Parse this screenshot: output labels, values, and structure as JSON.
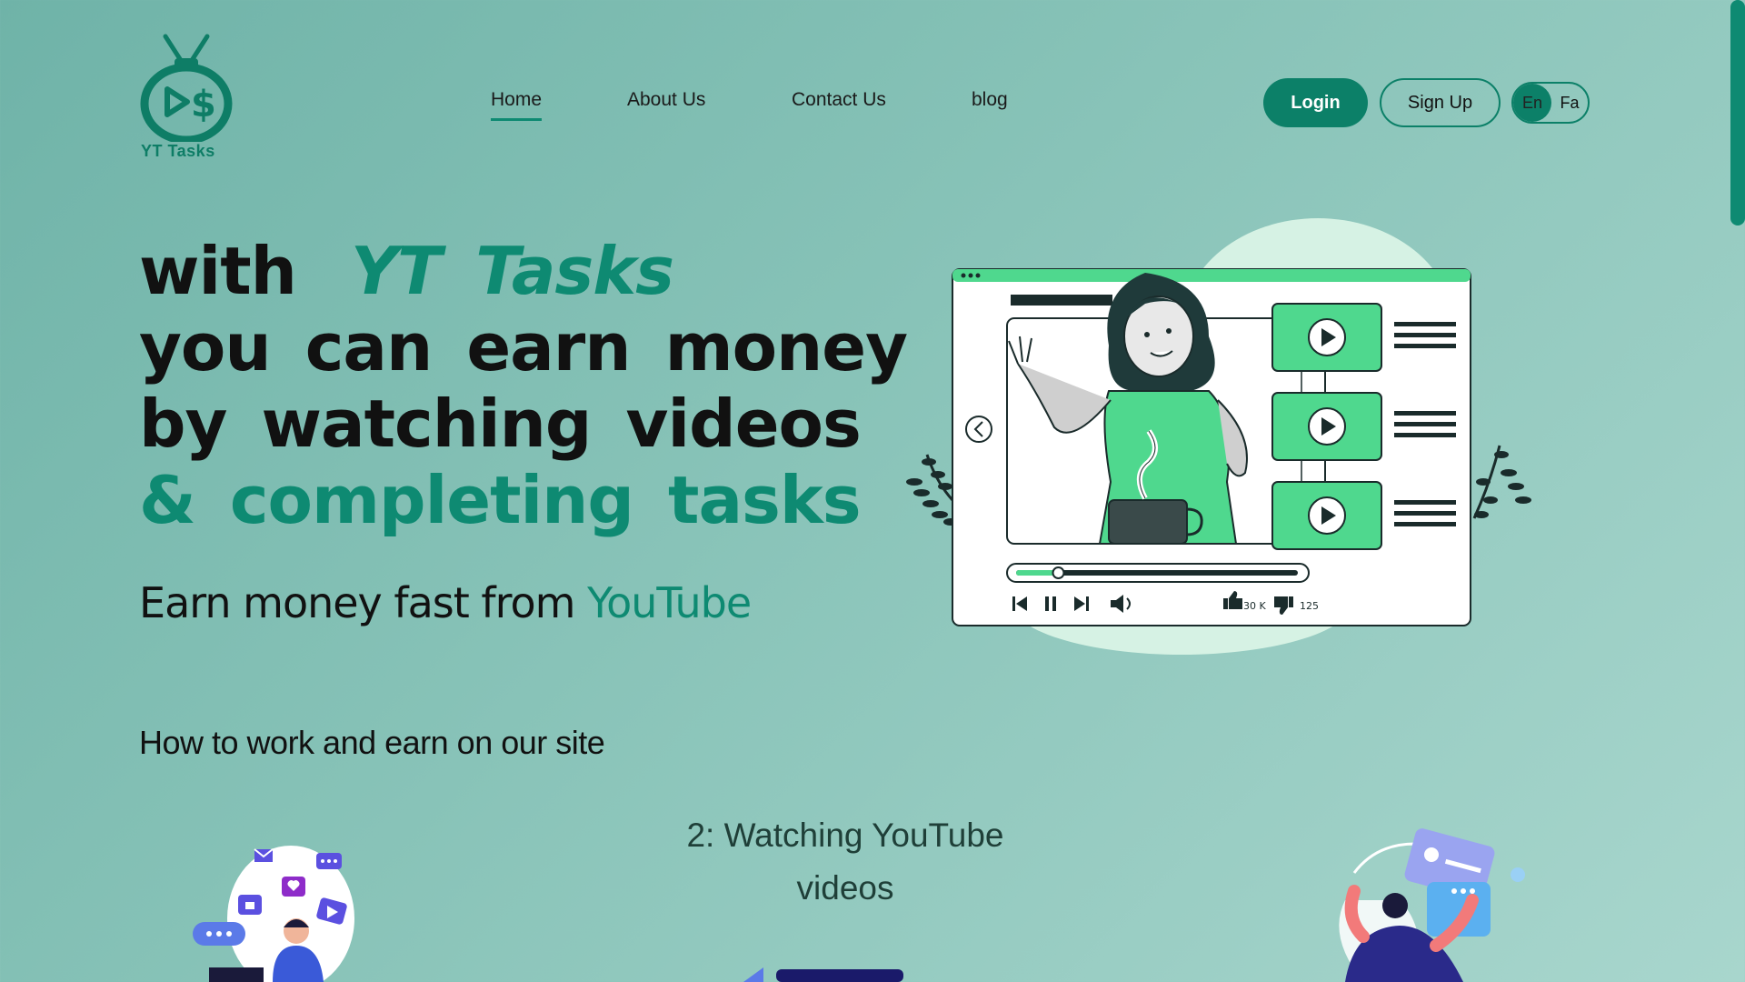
{
  "brand": {
    "logo_text": "YT Tasks",
    "accent": "#0e8a72",
    "button_green": "#0c8068"
  },
  "nav": {
    "items": [
      {
        "label": "Home",
        "active": true
      },
      {
        "label": "About Us"
      },
      {
        "label": "Contact Us"
      },
      {
        "label": "blog"
      }
    ]
  },
  "auth": {
    "login_label": "Login",
    "signup_label": "Sign Up"
  },
  "language": {
    "options": [
      "En",
      "Fa"
    ],
    "selected": "En"
  },
  "hero": {
    "line1_prefix": "with",
    "line1_brand": "YT Tasks",
    "line2": "you can earn money",
    "line3": "by watching videos",
    "line4": "& completing tasks",
    "subline_prefix": "Earn money fast from",
    "subline_highlight": "YouTube"
  },
  "video_player": {
    "likes": "30 K",
    "dislikes": "125",
    "progress": 0.15,
    "icons": [
      "back-arrow-icon",
      "play-icon",
      "skip-back-icon",
      "pause-icon",
      "skip-forward-icon",
      "volume-icon",
      "thumbs-up-icon",
      "thumbs-down-icon"
    ]
  },
  "how_section": {
    "title": "How to work and earn on our site",
    "step_title_line1": "2: Watching YouTube",
    "step_title_line2": "videos"
  }
}
